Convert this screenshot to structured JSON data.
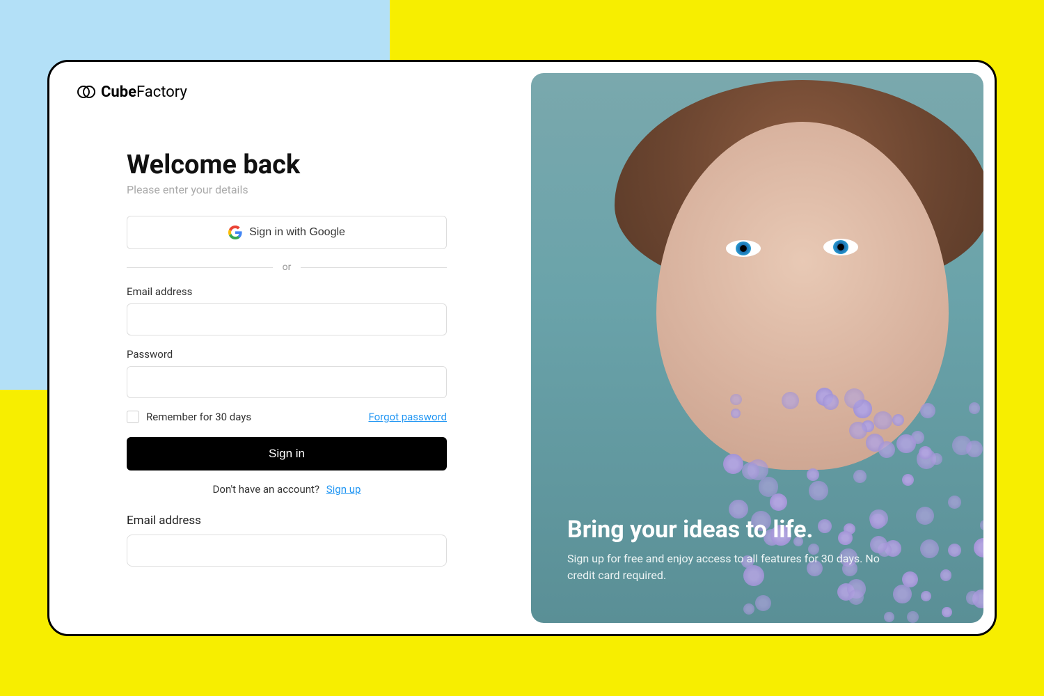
{
  "brand": {
    "name_bold": "Cube",
    "name_rest": "Factory"
  },
  "form": {
    "title": "Welcome back",
    "subtitle": "Please enter your details",
    "google_label": "Sign in with Google",
    "divider": "or",
    "email_label": "Email address",
    "password_label": "Password",
    "remember_label": "Remember for 30 days",
    "forgot_label": "Forgot password",
    "signin_label": "Sign in",
    "signup_prompt": "Don't have an account?",
    "signup_link": "Sign up",
    "extra_email_label": "Email address"
  },
  "hero": {
    "title": "Bring your ideas to life.",
    "subtitle": "Sign up for free and enjoy access to all features for 30 days. No credit card required."
  }
}
